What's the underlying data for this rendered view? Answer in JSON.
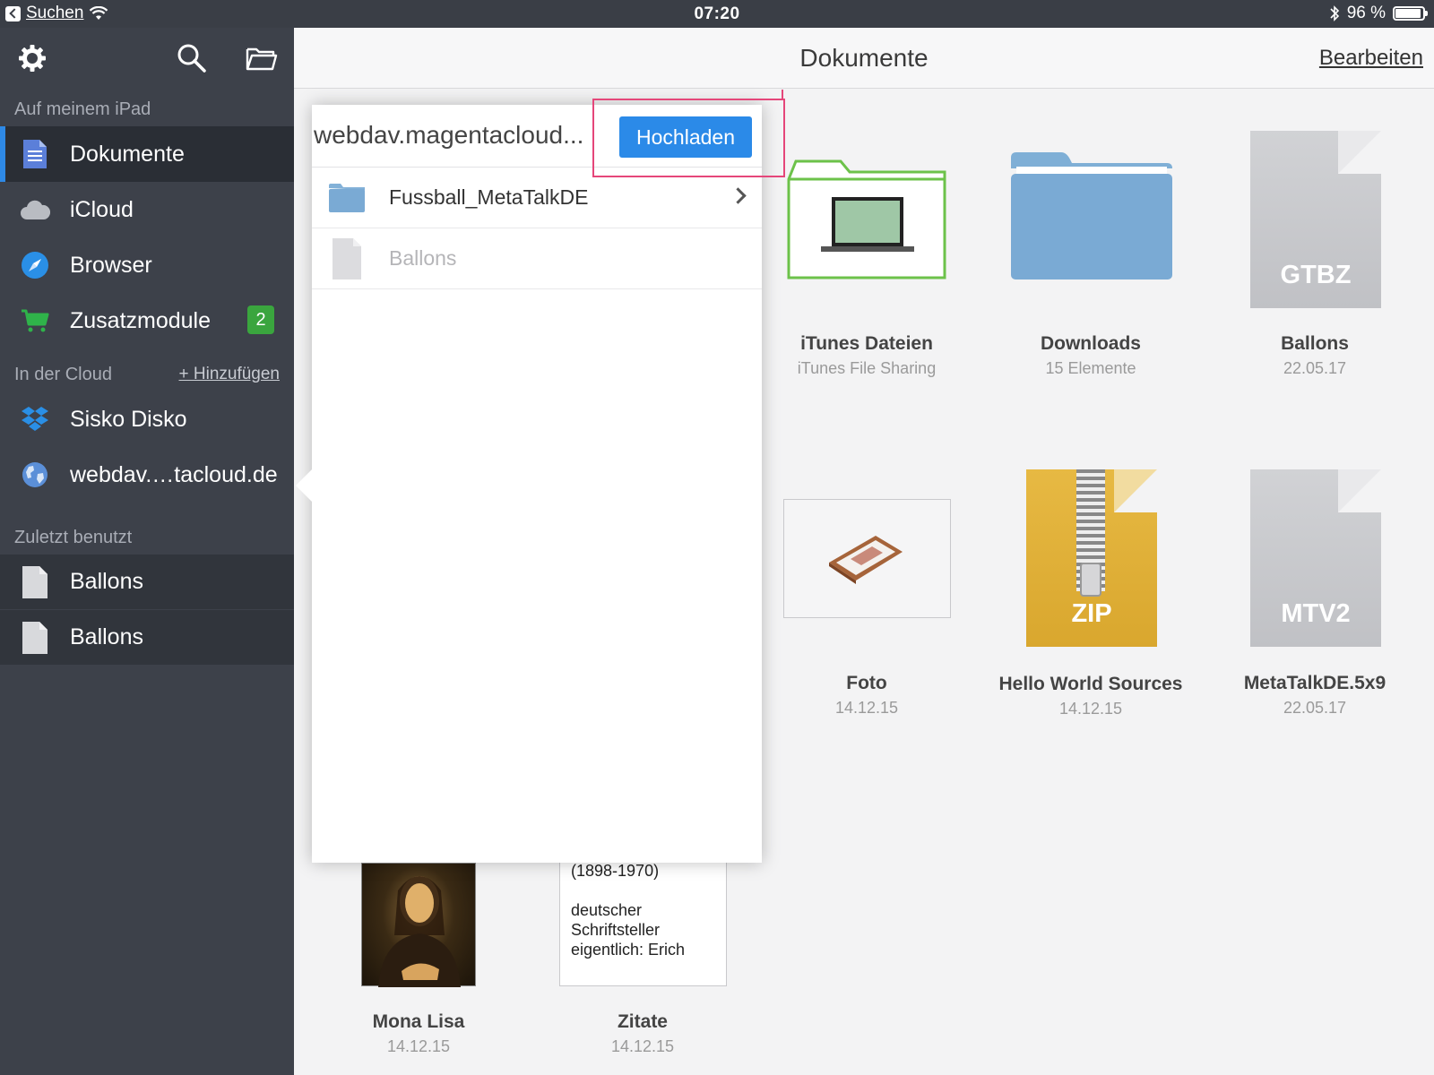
{
  "status_bar": {
    "back_label": "Suchen",
    "time": "07:20",
    "battery": "96 %"
  },
  "sidebar": {
    "section_ipad": "Auf meinem iPad",
    "items": [
      {
        "label": "Dokumente",
        "icon": "document-icon"
      },
      {
        "label": "iCloud",
        "icon": "cloud-icon"
      },
      {
        "label": "Browser",
        "icon": "compass-icon"
      },
      {
        "label": "Zusatzmodule",
        "icon": "cart-icon",
        "badge": "2"
      }
    ],
    "section_cloud": "In der Cloud",
    "add_label": "+ Hinzufügen",
    "cloud_items": [
      {
        "label": "Sisko Disko",
        "icon": "dropbox-icon"
      },
      {
        "label": "webdav.…tacloud.de",
        "icon": "globe-icon"
      }
    ],
    "section_recent": "Zuletzt benutzt",
    "recent_items": [
      {
        "label": "Ballons",
        "icon": "file-icon"
      },
      {
        "label": "Ballons",
        "icon": "file-icon"
      }
    ]
  },
  "main": {
    "title": "Dokumente",
    "edit_label": "Bearbeiten",
    "tiles": [
      {
        "name": "iTunes Dateien",
        "sub": "iTunes File Sharing"
      },
      {
        "name": "Downloads",
        "sub": "15 Elemente"
      },
      {
        "name": "Ballons",
        "sub": "22.05.17",
        "ext": "GTBZ"
      },
      {
        "name": "Foto",
        "sub": "14.12.15"
      },
      {
        "name": "Hello World Sources",
        "sub": "14.12.15",
        "ext": "ZIP"
      },
      {
        "name": "MetaTalkDE.5x9",
        "sub": "22.05.17",
        "ext": "MTV2"
      },
      {
        "name": "Mona Lisa",
        "sub": "14.12.15"
      },
      {
        "name": "Zitate",
        "sub": "14.12.15"
      }
    ],
    "zitate_preview": [
      "(1898-1970)",
      "deutscher",
      "Schriftsteller",
      "eigentlich: Erich"
    ]
  },
  "popover": {
    "title": "webdav.magentacloud...",
    "upload_label": "Hochladen",
    "rows": [
      {
        "label": "Fussball_MetaTalkDE",
        "icon": "folder-icon",
        "enabled": true
      },
      {
        "label": "Ballons",
        "icon": "file-icon",
        "enabled": false
      }
    ]
  },
  "colors": {
    "sidebar_bg": "#3d414a",
    "accent_blue": "#2b8ae8",
    "badge_green": "#3aa53e",
    "highlight_pink": "#e5467a"
  }
}
